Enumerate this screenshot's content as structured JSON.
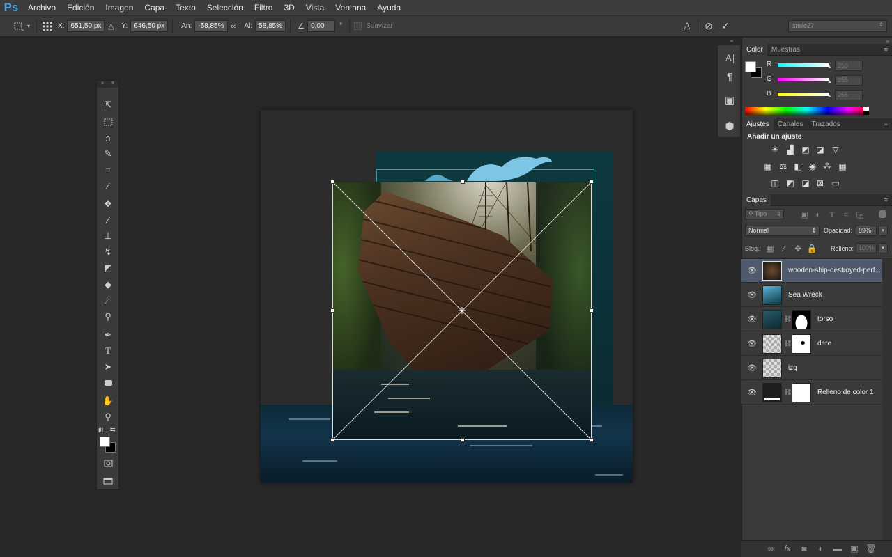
{
  "app": {
    "logo": "Ps"
  },
  "menu": [
    "Archivo",
    "Edición",
    "Imagen",
    "Capa",
    "Texto",
    "Selección",
    "Filtro",
    "3D",
    "Vista",
    "Ventana",
    "Ayuda"
  ],
  "options": {
    "x_label": "X:",
    "x_value": "651,50 px",
    "y_label": "Y:",
    "y_value": "646,50 px",
    "w_label": "An:",
    "w_value": "-58,85%",
    "h_label": "Al:",
    "h_value": "58,85%",
    "angle_value": "0,00",
    "angle_unit": "°",
    "smooth_label": "Suavizar",
    "workspace_value": "smile27"
  },
  "color_panel": {
    "tabs": [
      "Color",
      "Muestras"
    ],
    "r_label": "R",
    "r_value": "255",
    "g_label": "G",
    "g_value": "255",
    "b_label": "B",
    "b_value": "255"
  },
  "adjust_panel": {
    "tabs": [
      "Ajustes",
      "Canales",
      "Trazados"
    ],
    "heading": "Añadir un ajuste"
  },
  "layers_panel": {
    "tab": "Capas",
    "filter_label": "Tipo",
    "blend_mode": "Normal",
    "opacity_label": "Opacidad:",
    "opacity_value": "89%",
    "lock_label": "Bloq.:",
    "fill_label": "Relleno:",
    "fill_value": "100%",
    "layers": [
      {
        "name": "wooden-ship-destroyed-perf...",
        "selected": true
      },
      {
        "name": "Sea Wreck",
        "selected": false
      },
      {
        "name": "torso",
        "selected": false
      },
      {
        "name": "dere",
        "selected": false
      },
      {
        "name": "izq",
        "selected": false
      },
      {
        "name": "Relleno de color 1",
        "selected": false
      }
    ]
  },
  "colors": {
    "accent": "#4aa3df",
    "selected_layer": "#4f5b6c",
    "teal": "#0d3a40"
  }
}
